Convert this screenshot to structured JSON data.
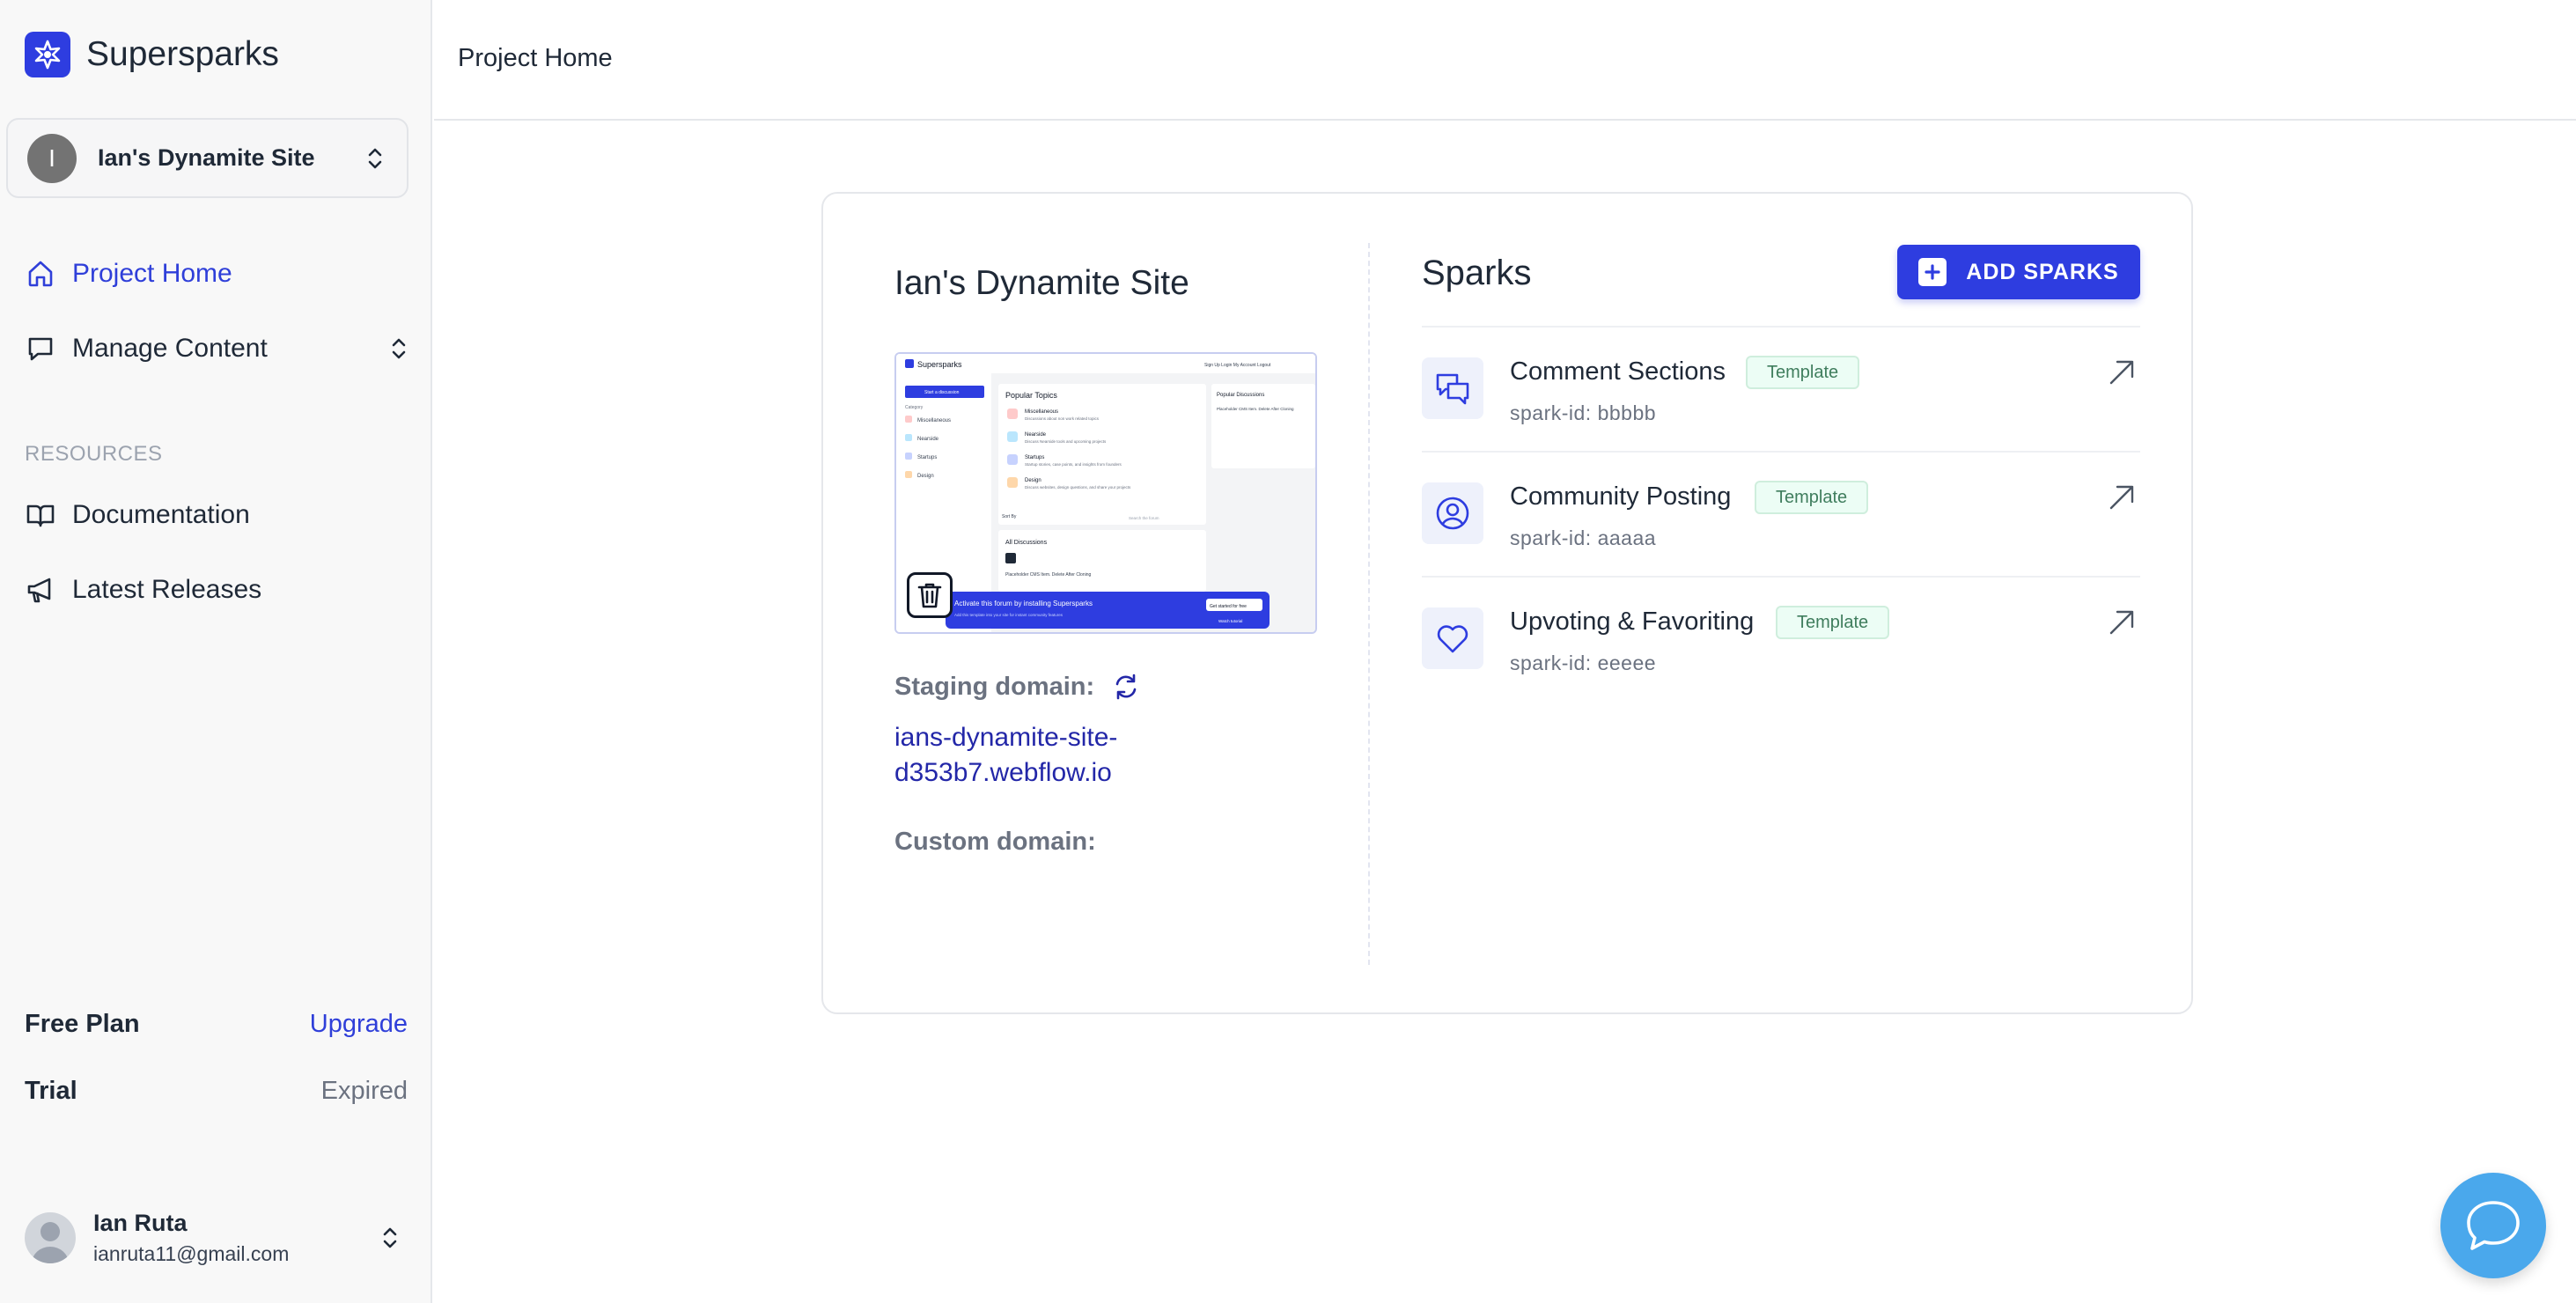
{
  "brand": {
    "name": "Supersparks",
    "accent": "#2e3de0"
  },
  "site_switcher": {
    "initial": "I",
    "name": "Ian's Dynamite Site"
  },
  "nav": {
    "project_home": "Project Home",
    "manage_content": "Manage Content",
    "resources_label": "RESOURCES",
    "documentation": "Documentation",
    "latest_releases": "Latest Releases"
  },
  "plan": {
    "free_plan_label": "Free Plan",
    "upgrade_label": "Upgrade",
    "trial_label": "Trial",
    "trial_status": "Expired"
  },
  "user": {
    "name": "Ian Ruta",
    "email": "ianruta11@gmail.com"
  },
  "header": {
    "title": "Project Home"
  },
  "project": {
    "title": "Ian's Dynamite Site",
    "staging_label": "Staging domain:",
    "staging_url": "ians-dynamite-site-d353b7.webflow.io",
    "custom_label": "Custom domain:"
  },
  "preview": {
    "brand": "Supersparks",
    "top_links": "Sign Up   Login   My Account   Logout",
    "new_discussion": "Start a discussion",
    "sidebar_heading": "Category",
    "sidebar_items": [
      "Miscellaneous",
      "Nearside",
      "Startups",
      "Design"
    ],
    "popular_topics": "Popular Topics",
    "topics": [
      {
        "name": "Miscellaneous",
        "desc": "Discussions about non work related topics"
      },
      {
        "name": "Nearside",
        "desc": "Discuss Nearside tools and upcoming projects"
      },
      {
        "name": "Startups",
        "desc": "Startup stories, case points, and insights from founders"
      },
      {
        "name": "Design",
        "desc": "Discuss websites, design questions, and share your projects"
      }
    ],
    "popular_discussions": "Popular Discussions",
    "popular_item": "Placeholder CMS Item. Delete After Cloning",
    "sort_label": "Sort By",
    "search_placeholder": "Search the forum",
    "all_discussions": "All Discussions",
    "discussion_item": "Placeholder CMS Item. Delete After Cloning",
    "banner_title": "Activate this forum by installing Supersparks",
    "banner_sub": "Add this template into your site for instant community features",
    "banner_cta": "Get started for free",
    "banner_link": "Watch tutorial"
  },
  "sparks": {
    "title": "Sparks",
    "add_label": "ADD SPARKS",
    "items": [
      {
        "name": "Comment Sections",
        "badge": "Template",
        "id": "spark-id: bbbbb",
        "icon": "comments-icon"
      },
      {
        "name": "Community Posting",
        "badge": "Template",
        "id": "spark-id: aaaaa",
        "icon": "user-circle-icon"
      },
      {
        "name": "Upvoting & Favoriting",
        "badge": "Template",
        "id": "spark-id: eeeee",
        "icon": "heart-icon"
      }
    ]
  },
  "colors": {
    "link": "#2f3fd9",
    "staging_link": "#2327a8",
    "badge_bg": "#ecfdf5",
    "chat": "#4aa8ec"
  }
}
